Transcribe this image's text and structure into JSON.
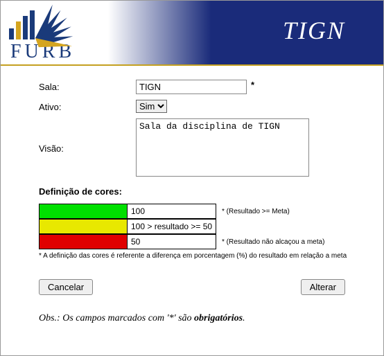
{
  "header": {
    "logo_text": "FURB",
    "app_title": "TIGN"
  },
  "form": {
    "sala": {
      "label": "Sala:",
      "value": "TIGN",
      "required_mark": "*"
    },
    "ativo": {
      "label": "Ativo:",
      "selected": "Sim"
    },
    "visao": {
      "label": "Visão:",
      "value": "Sala da disciplina de TIGN"
    }
  },
  "colors": {
    "section_title": "Definição de cores:",
    "rows": [
      {
        "swatch": "#00e000",
        "value": "100",
        "note": "* (Resultado >= Meta)"
      },
      {
        "swatch": "#e8e800",
        "value": "100 > resultado >= 50",
        "note": ""
      },
      {
        "swatch": "#e00000",
        "value": "50",
        "note": "* (Resultado não alcaçou a meta)"
      }
    ],
    "footnote": "* A definição das cores é referente a diferença em porcentagem (%) do resultado em relação a meta"
  },
  "buttons": {
    "cancel": "Cancelar",
    "alter": "Alterar"
  },
  "obs": {
    "prefix": "Obs.: Os campos marcados com '*' são ",
    "strong": "obrigatórios",
    "suffix": "."
  }
}
